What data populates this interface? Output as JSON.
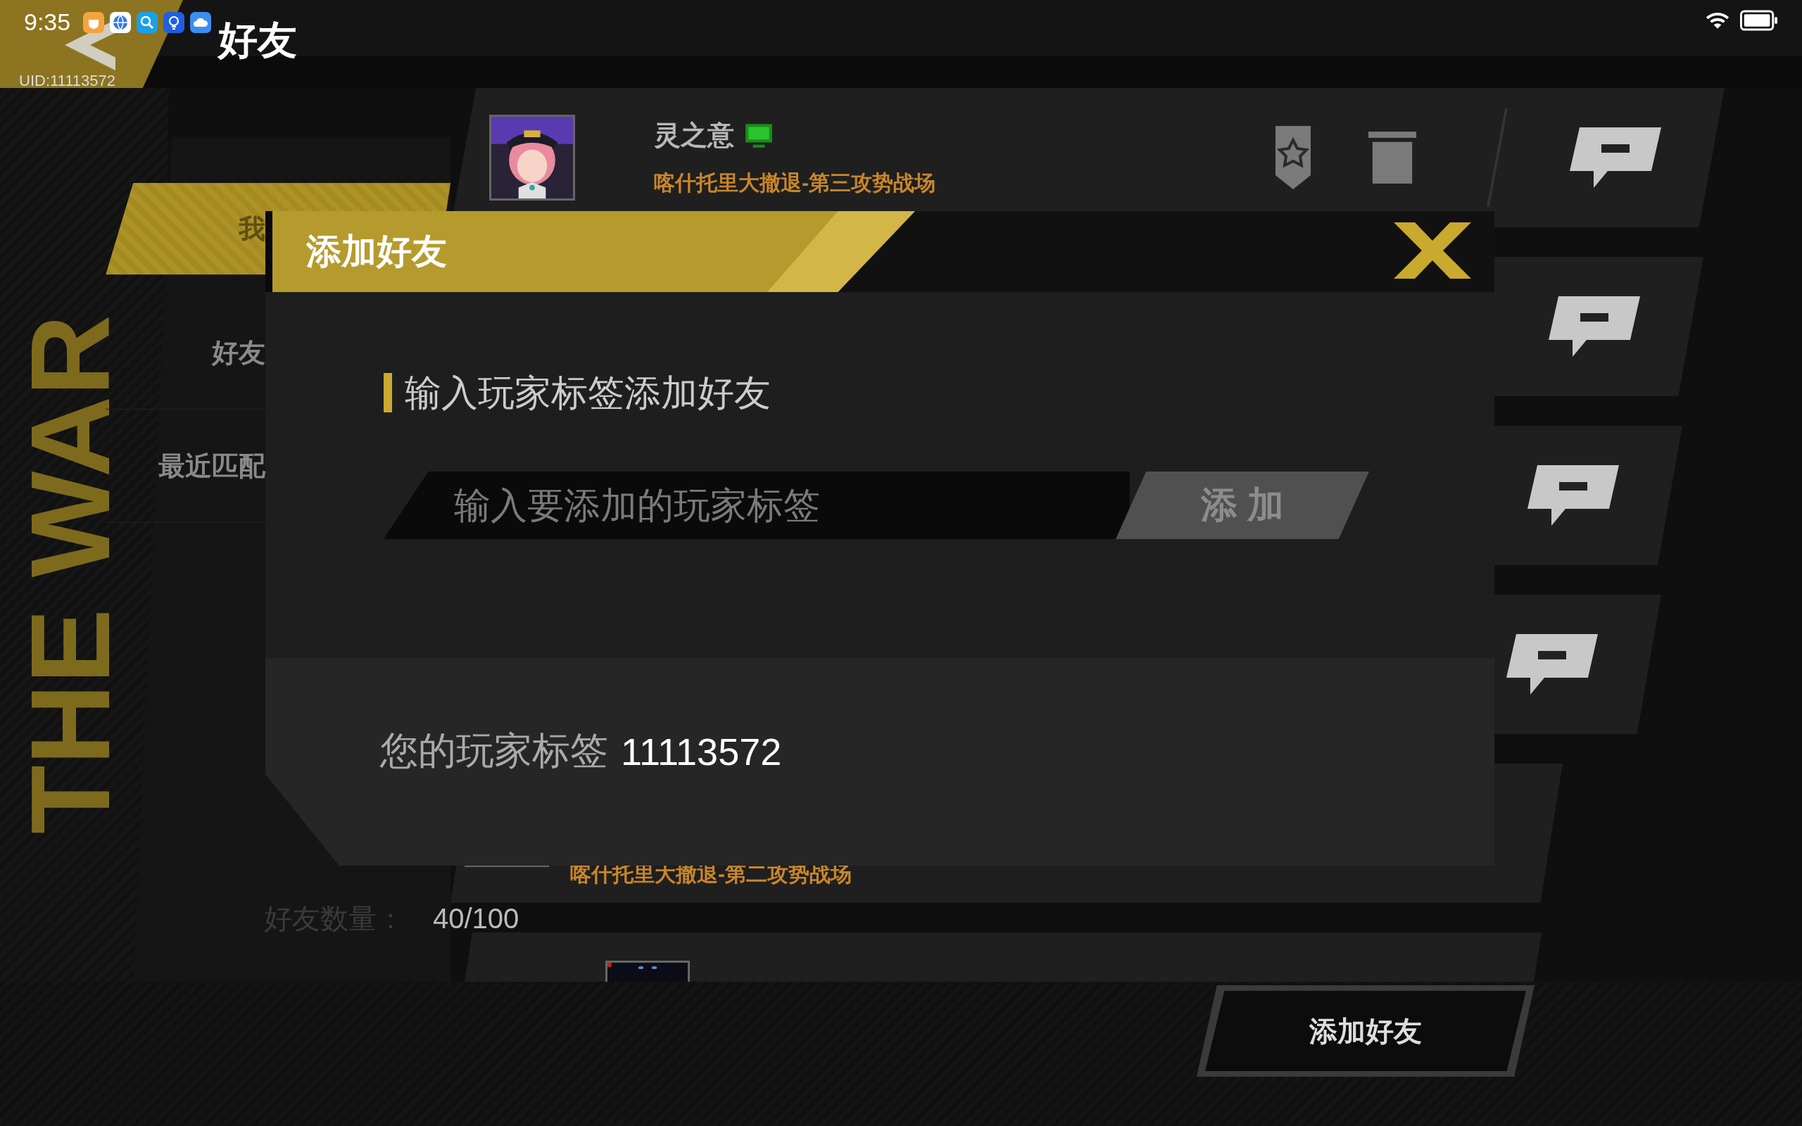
{
  "status_bar": {
    "time": "9:35"
  },
  "header": {
    "title": "好友",
    "uid": "UID:11113572"
  },
  "banner_text": "THE WAR",
  "tabs": [
    {
      "label": "我",
      "selected": true
    },
    {
      "label": "好友",
      "selected": false
    },
    {
      "label": "最近匹配",
      "selected": false
    }
  ],
  "friends": [
    {
      "kind": "full",
      "name": "灵之意",
      "online": true,
      "location": "喀什托里大撤退-第三攻势战场"
    },
    {
      "kind": "covered"
    },
    {
      "kind": "covered"
    },
    {
      "kind": "covered"
    },
    {
      "kind": "bottom",
      "location": "喀什托里大撤退-第二攻势战场"
    },
    {
      "kind": "cut"
    }
  ],
  "friend_count": {
    "label": "好友数量：",
    "value": "40/100"
  },
  "add_button": "添加好友",
  "dialog": {
    "title": "添加好友",
    "section_label": "输入玩家标签添加好友",
    "input": {
      "placeholder": "输入要添加的玩家标签"
    },
    "submit": "添 加",
    "tag_label": "您的玩家标签",
    "tag_value": "11113572"
  }
}
